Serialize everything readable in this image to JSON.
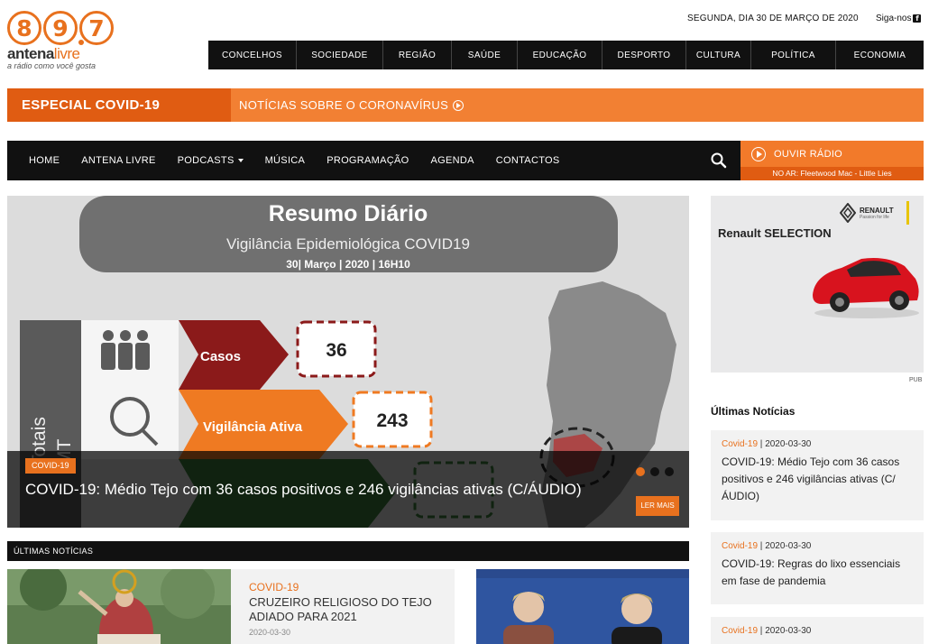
{
  "logo": {
    "digits": [
      "8",
      "9",
      "7"
    ],
    "brand_main": "antena",
    "brand_accent": "livre",
    "tagline": "a rádio como você gosta"
  },
  "header": {
    "date": "SEGUNDA, DIA 30 DE MARÇO DE 2020",
    "follow": "Siga-nos",
    "follow_icon": "facebook-icon"
  },
  "topnav": [
    "CONCELHOS",
    "SOCIEDADE",
    "REGIÃO",
    "SAÚDE",
    "EDUCAÇÃO",
    "DESPORTO",
    "CULTURA",
    "POLÍTICA",
    "ECONOMIA"
  ],
  "covid_band": {
    "tag": "ESPECIAL COVID-19",
    "link": "NOTÍCIAS SOBRE O CORONAVÍRUS"
  },
  "mainnav": [
    "HOME",
    "ANTENA LIVRE",
    "PODCASTS",
    "MÚSICA",
    "PROGRAMAÇÃO",
    "AGENDA",
    "CONTACTOS"
  ],
  "radio": {
    "label": "OUVIR RÁDIO",
    "on_air": "NO AR: Fleetwood Mac - Little Lies"
  },
  "hero": {
    "image_heading": "Resumo Diário",
    "image_sub": "Vigilância Epidemiológica COVID19",
    "image_date": "30| Março | 2020 | 16H10",
    "side_label": "Totais",
    "side_label2": "MT",
    "row1_label": "Casos",
    "row1_value": "36",
    "row2_label": "Vigilância Ativa",
    "row2_value": "243",
    "category": "COVID-19",
    "title": "COVID-19: Médio Tejo com 36 casos positivos e 246 vigilâncias ativas (C/ÁUDIO)",
    "more": "LER MAIS",
    "slides": 3,
    "active_slide": 1
  },
  "latest": {
    "bar_title": "ÚLTIMAS NOTÍCIAS",
    "card": {
      "category": "COVID-19",
      "title": "CRUZEIRO RELIGIOSO DO TEJO ADIADO PARA 2021",
      "date": "2020-03-30"
    }
  },
  "ad": {
    "headline": "Renault SELECTION",
    "logo": "RENAULT",
    "logo_sub": "Passion for life",
    "pub": "PUB"
  },
  "sidebar": {
    "title": "Últimas Notícias",
    "items": [
      {
        "category": "Covid-19",
        "date": "2020-03-30",
        "title": "COVID-19: Médio Tejo com 36 casos positivos e 246 vigilâncias ativas (C/ÁUDIO)"
      },
      {
        "category": "Covid-19",
        "date": "2020-03-30",
        "title": "COVID-19: Regras do lixo essenciais em fase de pandemia"
      },
      {
        "category": "Covid-19",
        "date": "2020-03-30",
        "title": ""
      }
    ]
  },
  "colors": {
    "accent": "#e8711e",
    "dark": "#111111",
    "covid_dark": "#e05c12"
  }
}
